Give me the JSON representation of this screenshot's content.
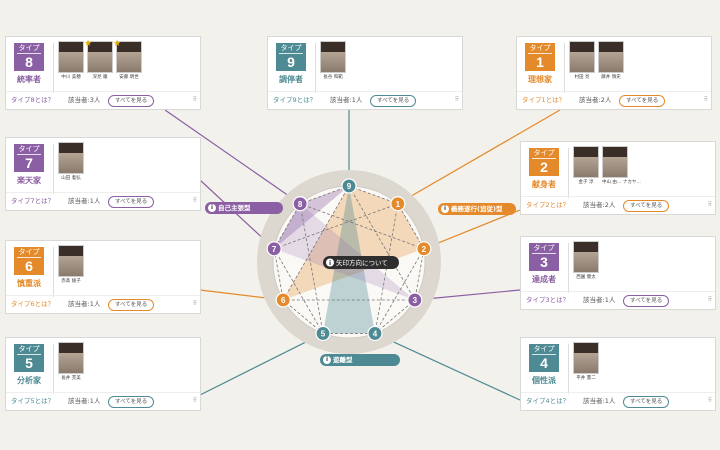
{
  "center_label": "矢印方向について",
  "directions": [
    {
      "label": "自己主張型",
      "color": "#8b5fa3"
    },
    {
      "label": "義務遂行(追従)型",
      "color": "#e58a2a"
    },
    {
      "label": "遊離型",
      "color": "#4e8a93"
    }
  ],
  "nodes": [
    {
      "num": "9",
      "color": "#4e8a93"
    },
    {
      "num": "1",
      "color": "#e58a2a"
    },
    {
      "num": "2",
      "color": "#e58a2a"
    },
    {
      "num": "3",
      "color": "#8b5fa3"
    },
    {
      "num": "4",
      "color": "#4e8a93"
    },
    {
      "num": "5",
      "color": "#4e8a93"
    },
    {
      "num": "6",
      "color": "#e58a2a"
    },
    {
      "num": "7",
      "color": "#8b5fa3"
    },
    {
      "num": "8",
      "color": "#8b5fa3"
    }
  ],
  "cards": [
    {
      "type_label": "タイプ",
      "num": "8",
      "name": "統率者",
      "color": "#8b5fa3",
      "what": "タイプ8とは？",
      "count": "該当者:3人",
      "more": "すべてを見る",
      "people": [
        {
          "name": "中川 美穂",
          "star": false
        },
        {
          "name": "深見 瞳",
          "star": true
        },
        {
          "name": "安藤 明世",
          "star": true
        }
      ]
    },
    {
      "type_label": "タイプ",
      "num": "9",
      "name": "調停者",
      "color": "#4e8a93",
      "what": "タイプ9とは？",
      "count": "該当者:1人",
      "more": "すべてを見る",
      "people": [
        {
          "name": "長谷 和範",
          "star": false
        }
      ]
    },
    {
      "type_label": "タイプ",
      "num": "1",
      "name": "理想家",
      "color": "#e58a2a",
      "what": "タイプ1とは？",
      "count": "該当者:2人",
      "more": "すべてを見る",
      "people": [
        {
          "name": "村田 亮",
          "star": false
        },
        {
          "name": "藤井 慎史",
          "star": false
        }
      ]
    },
    {
      "type_label": "タイプ",
      "num": "7",
      "name": "楽天家",
      "color": "#8b5fa3",
      "what": "タイプ7とは？",
      "count": "該当者:1人",
      "more": "すべてを見る",
      "people": [
        {
          "name": "山田 着弘",
          "star": false
        }
      ]
    },
    {
      "type_label": "タイプ",
      "num": "2",
      "name": "献身者",
      "color": "#e58a2a",
      "what": "タイプ2とは？",
      "count": "該当者:2人",
      "more": "すべてを見る",
      "people": [
        {
          "name": "金子 淳",
          "star": false
        },
        {
          "name": "中山 由… ナカヤ…",
          "star": false
        }
      ]
    },
    {
      "type_label": "タイプ",
      "num": "6",
      "name": "慎重派",
      "color": "#e58a2a",
      "what": "タイプ6とは？",
      "count": "該当者:1人",
      "more": "すべてを見る",
      "people": [
        {
          "name": "赤髙 綾子",
          "star": false
        }
      ]
    },
    {
      "type_label": "タイプ",
      "num": "3",
      "name": "達成者",
      "color": "#8b5fa3",
      "what": "タイプ3とは？",
      "count": "該当者:1人",
      "more": "すべてを見る",
      "people": [
        {
          "name": "西園 健太",
          "star": false
        }
      ]
    },
    {
      "type_label": "タイプ",
      "num": "5",
      "name": "分析家",
      "color": "#4e8a93",
      "what": "タイプ5とは？",
      "count": "該当者:1人",
      "more": "すべてを見る",
      "people": [
        {
          "name": "長井 芙美",
          "star": false
        }
      ]
    },
    {
      "type_label": "タイプ",
      "num": "4",
      "name": "個性派",
      "color": "#4e8a93",
      "what": "タイプ4とは？",
      "count": "該当者:1人",
      "more": "すべてを見る",
      "people": [
        {
          "name": "平井 憲二",
          "star": false
        }
      ]
    }
  ]
}
